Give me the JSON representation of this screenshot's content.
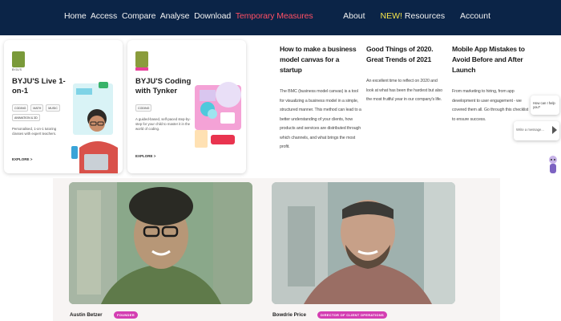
{
  "nav": {
    "left_items": [
      "Home",
      "Access",
      "Compare",
      "Analyse",
      "Download"
    ],
    "highlight_item": "Temporary Measures",
    "about": "About",
    "new_badge": "NEW!",
    "resources": "Resources",
    "account": "Account"
  },
  "cards": [
    {
      "logo_sub": "BYJU'S",
      "title": "BYJU'S Live 1-on-1",
      "tags": [
        "CODING",
        "MATH",
        "MUSIC",
        "ANIMATION & 3D"
      ],
      "description": "Personalised, 1-on-1 tutoring classes with expert teachers.",
      "explore": "EXPLORE >"
    },
    {
      "logo_sub": "",
      "title": "BYJU'S Coding with Tynker",
      "tags": [
        "CODING"
      ],
      "description": "A guided-based, self-paced step-by-step for your child to master it in the world of coding.",
      "explore": "EXPLORE >"
    }
  ],
  "blog": [
    {
      "title": "How to make a business model canvas for a startup",
      "excerpt": "The BMC (business model canvas) is a tool for visualizing a business model in a simple, structured manner. This method can lead to a better understanding of your clients, how products and services are distributed through which channels, and what brings the most profit."
    },
    {
      "title": "Good Things of 2020. Great Trends of 2021",
      "excerpt": "An excellent time to reflect on 2020 and look at what has been the hardest but also the most fruitful year in our company's life."
    },
    {
      "title": "Mobile App Mistakes to Avoid Before and After Launch",
      "excerpt": "From marketing to hiring, from app development to user engagement - we covered them all. Go through this checklist to ensure success."
    }
  ],
  "chat": {
    "greeting": "How can I help you?",
    "input_placeholder": "Write a message..."
  },
  "team": [
    {
      "name": "Austin Betzer",
      "role": "FOUNDER"
    },
    {
      "name": "Bowdrie Price",
      "role": "DIRECTOR OF CLIENT OPERATIONS"
    }
  ],
  "colors": {
    "nav_bg": "#0b2447",
    "highlight": "#ff4f64",
    "new_badge": "#f5e44a",
    "role_badge": "#d43eb2"
  }
}
